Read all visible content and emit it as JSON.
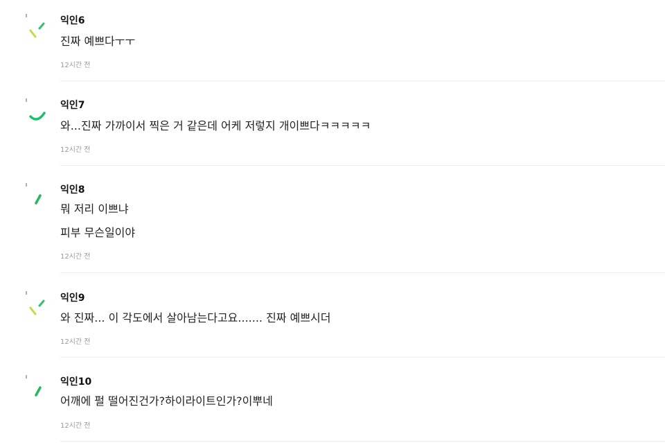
{
  "comments": [
    {
      "author": "익인6",
      "lines": [
        "진짜 예쁘다ㅜㅜ"
      ],
      "time": "12시간 전",
      "avatar_icon": "spark-icon",
      "avatar_colors": [
        "#c9d93a",
        "#36c06e"
      ]
    },
    {
      "author": "익인7",
      "lines": [
        "와...진짜 가까이서 찍은 거 같은데 어케 저렇지 개이쁘다ㅋㅋㅋㅋㅋ"
      ],
      "time": "12시간 전",
      "avatar_icon": "smile-arc-icon",
      "avatar_colors": [
        "#1fbf6e"
      ]
    },
    {
      "author": "익인8",
      "lines": [
        "뭐 저리 이쁘냐",
        "피부 무슨일이야"
      ],
      "time": "12시간 전",
      "avatar_icon": "dash-icon",
      "avatar_colors": [
        "#23b85a"
      ]
    },
    {
      "author": "익인9",
      "lines": [
        "와 진짜... 이 각도에서 살아남는다고요....... 진짜 예쁘시더"
      ],
      "time": "12시간 전",
      "avatar_icon": "spark-icon",
      "avatar_colors": [
        "#c9d93a",
        "#36c06e"
      ]
    },
    {
      "author": "익인10",
      "lines": [
        "어깨에 펄 떨어진건가?하이라이트인가?이뿌네"
      ],
      "time": "12시간 전",
      "avatar_icon": "dash-icon",
      "avatar_colors": [
        "#23b85a"
      ]
    }
  ]
}
